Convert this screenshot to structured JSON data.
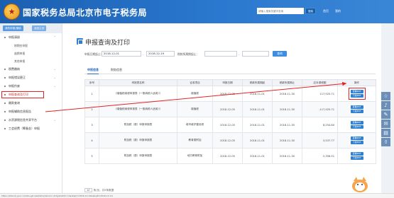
{
  "header": {
    "brand": "国家税务总局北京市电子税务局",
    "search_placeholder": "请输入搜索关键字查询",
    "search_label": "搜索",
    "nav": [
      "首页",
      "我的"
    ]
  },
  "sidebar": {
    "user_buttons": [
      "我的申报/缴纳",
      "返回主页"
    ],
    "menu": [
      {
        "label": "申报清册",
        "expanded": true
      },
      {
        "label": "按期应申报",
        "sub": true
      },
      {
        "label": "逾期申报",
        "sub": true
      },
      {
        "label": "其他申报",
        "sub": true
      },
      {
        "label": "税费缴纳"
      },
      {
        "label": "申报错误更正"
      },
      {
        "label": "申报作废"
      },
      {
        "label": "申报查询及打印",
        "active": true
      },
      {
        "label": "缴款查询"
      },
      {
        "label": "申报辅助信息报告"
      },
      {
        "label": "水资源税信息共享平台"
      },
      {
        "label": "工会经费（筹备金）申报"
      }
    ]
  },
  "main": {
    "title": "申报查询及打印",
    "filters": {
      "period_label": "申报日期起止：",
      "date_from": "2018-12-01",
      "date_to": "2018-12-19",
      "tax_period_label": "税款所属期起止：",
      "tax_from": "",
      "tax_to": "",
      "sep": "-",
      "query_label": "查询"
    },
    "tabs": [
      "申报信息",
      "财务信息"
    ],
    "columns": [
      "序号",
      "申报表名称",
      "征收项目",
      "申报日期",
      "税款所属期起",
      "税款所属期止",
      "应补退税额",
      "操作"
    ],
    "rows": [
      {
        "no": "1",
        "name": "《增值税纳税申报表（一般纳税人适用）》",
        "item": "增值税",
        "date": "2018-12-05",
        "from": "2018-11-01",
        "to": "2018-11-30",
        "amount": "117,925.71"
      },
      {
        "no": "2",
        "name": "《增值税纳税申报表（一般纳税人适用）》",
        "item": "增值税",
        "date": "2018-12-05",
        "from": "2018-11-01",
        "to": "2018-11-30",
        "amount": "-117,925.71"
      },
      {
        "no": "3",
        "name": "附加税（费）申报申报表",
        "item": "城市维护建设税",
        "date": "2018-12-05",
        "from": "2018-11-01",
        "to": "2018-11-30",
        "amount": "8,254.80"
      },
      {
        "no": "4",
        "name": "附加税（费）申报申报表",
        "item": "教育费附加",
        "date": "2018-12-05",
        "from": "2018-11-01",
        "to": "2018-11-30",
        "amount": "3,537.77"
      },
      {
        "no": "5",
        "name": "附加税（费）申报申报表",
        "item": "地方教育附加",
        "date": "2018-12-05",
        "from": "2018-11-01",
        "to": "2018-11-30",
        "amount": "2,358.51"
      }
    ],
    "op_view": "查看PDF",
    "op_download": "下载PDF",
    "pager": {
      "size": "10",
      "text": "条/页，共5条数据"
    }
  },
  "statusbar": "https://etax.bj.gov.cn/xxbs-gzl-web/sbxx/sbxxcx.do?gdslxDm=1&sbsjQ=2018-12-01&sbsjZ=2018-12-19"
}
